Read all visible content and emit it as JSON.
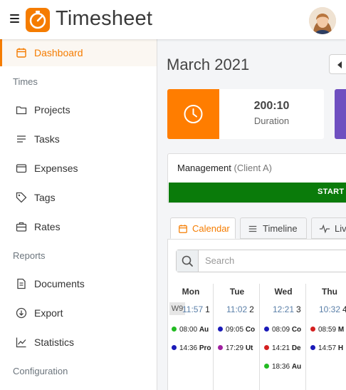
{
  "header": {
    "brand": "Timesheet"
  },
  "sidebar": {
    "items": [
      {
        "label": "Dashboard",
        "icon": "calendar-icon",
        "active": true
      },
      {
        "label": "Projects",
        "icon": "folder-icon"
      },
      {
        "label": "Tasks",
        "icon": "list-icon"
      },
      {
        "label": "Expenses",
        "icon": "wallet-icon"
      },
      {
        "label": "Tags",
        "icon": "tag-icon"
      },
      {
        "label": "Rates",
        "icon": "briefcase-icon"
      },
      {
        "label": "Documents",
        "icon": "document-icon"
      },
      {
        "label": "Export",
        "icon": "download-icon"
      },
      {
        "label": "Statistics",
        "icon": "chart-icon"
      }
    ],
    "sections": [
      "Times",
      "Reports",
      "Configuration"
    ]
  },
  "main": {
    "title": "March 2021",
    "stat": {
      "value": "200:10",
      "label": "Duration",
      "icon": "clock-icon"
    },
    "project": {
      "name": "Management",
      "client": "(Client A)",
      "start_label": "START"
    },
    "tabs": [
      {
        "label": "Calendar",
        "icon": "calendar-icon",
        "active": true
      },
      {
        "label": "Timeline",
        "icon": "list-icon"
      },
      {
        "label": "Live",
        "icon": "pulse-icon"
      }
    ],
    "search": {
      "placeholder": "Search"
    },
    "week": "W9",
    "days": [
      {
        "name": "Mon",
        "total": "11:57",
        "count": "1",
        "entries": [
          {
            "time": "08:00",
            "text": "Au",
            "color": "#22bb22"
          },
          {
            "time": "14:36",
            "text": "Pro",
            "color": "#1a1ab8"
          }
        ]
      },
      {
        "name": "Tue",
        "total": "11:02",
        "count": "2",
        "entries": [
          {
            "time": "09:05",
            "text": "Co",
            "color": "#1a1ab8"
          },
          {
            "time": "17:29",
            "text": "Ut",
            "color": "#a020a0"
          }
        ]
      },
      {
        "name": "Wed",
        "total": "12:21",
        "count": "3",
        "entries": [
          {
            "time": "08:09",
            "text": "Co",
            "color": "#1a1ab8"
          },
          {
            "time": "14:21",
            "text": "De",
            "color": "#d42020"
          },
          {
            "time": "18:36",
            "text": "Au",
            "color": "#22bb22"
          }
        ]
      },
      {
        "name": "Thu",
        "total": "10:32",
        "count": "4",
        "entries": [
          {
            "time": "08:59",
            "text": "M",
            "color": "#d42020"
          },
          {
            "time": "14:57",
            "text": "H",
            "color": "#1a1ab8"
          }
        ]
      }
    ]
  },
  "colors": {
    "accent": "#f57c00",
    "start": "#0a7b0a",
    "stat_alt": "#6f4fc0"
  }
}
